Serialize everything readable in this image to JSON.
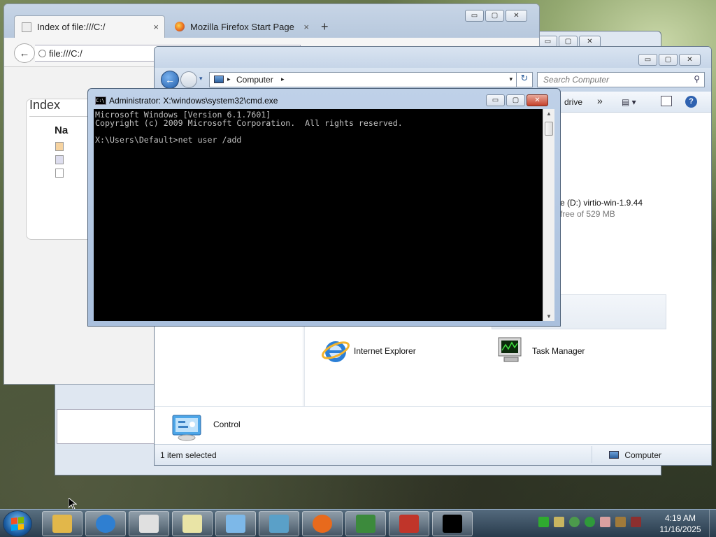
{
  "firefox": {
    "tabs": [
      {
        "label": "Index of file:///C:/",
        "close": "×"
      },
      {
        "label": "Mozilla Firefox Start Page",
        "close": "×"
      }
    ],
    "new_tab": "+",
    "back": "←",
    "url": "file:///C:/",
    "page": {
      "title": "Index",
      "name_header": "Na"
    }
  },
  "explorer": {
    "nav": {
      "back": "←",
      "dropdown": "▾"
    },
    "breadcrumb": {
      "item": "Computer",
      "arrow": "▸",
      "dropdown": "▾"
    },
    "refresh": "↻",
    "search_placeholder": "Search Computer",
    "search_icon": "⚲",
    "cmdbar": {
      "drive": "drive",
      "more": "»",
      "view": "▤ ▾",
      "help": "?"
    },
    "drive": {
      "label": "e (D:) virtio-win-1.9.44",
      "free": "free of 529 MB"
    },
    "items": [
      {
        "label": "Internet Explorer",
        "icon": "internet-explorer-icon"
      },
      {
        "label": "Task Manager",
        "icon": "task-manager-icon"
      },
      {
        "label": "Control",
        "icon": "control-panel-icon"
      }
    ],
    "status": {
      "left": "1 item selected",
      "right": "Computer"
    }
  },
  "cmd": {
    "title": "Administrator: X:\\windows\\system32\\cmd.exe",
    "icon_text": "C:\\",
    "lines": [
      "Microsoft Windows [Version 6.1.7601]",
      "Copyright (c) 2009 Microsoft Corporation.  All rights reserved.",
      "",
      "X:\\Users\\Default>net user /add"
    ],
    "scroll_up": "▲",
    "scroll_down": "▼"
  },
  "window_controls": {
    "minimize": "▭",
    "maximize": "▢",
    "close": "✕"
  },
  "taskbar": {
    "buttons": [
      {
        "name": "explorer",
        "color": "#e2b74a"
      },
      {
        "name": "internet-explorer",
        "color": "#2f7fd1"
      },
      {
        "name": "network",
        "color": "#e0e0e0"
      },
      {
        "name": "paint",
        "color": "#e9e4a6"
      },
      {
        "name": "control-panel",
        "color": "#7db8e8"
      },
      {
        "name": "photo-viewer",
        "color": "#5aa0c8"
      },
      {
        "name": "firefox",
        "color": "#e86a1c"
      },
      {
        "name": "task-manager",
        "color": "#3c8a3c"
      },
      {
        "name": "toolbox",
        "color": "#c0352a"
      },
      {
        "name": "cmd",
        "color": "#000000"
      }
    ],
    "clock": {
      "time": "4:19 AM",
      "date": "11/16/2025"
    }
  }
}
